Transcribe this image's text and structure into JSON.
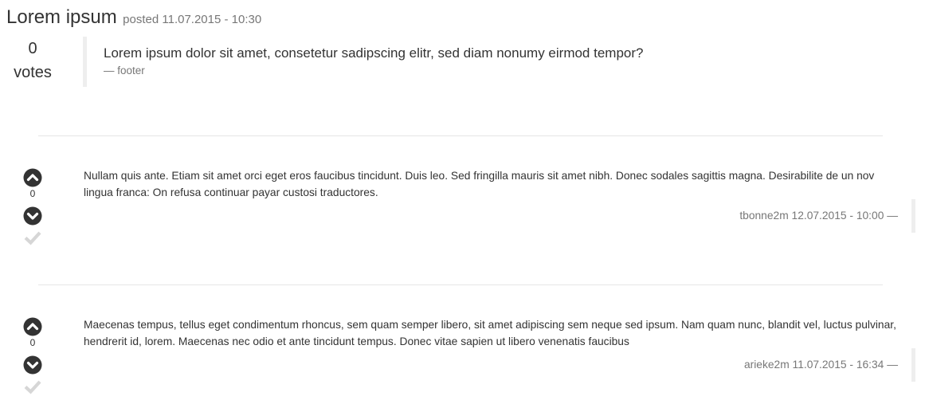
{
  "question": {
    "title": "Lorem ipsum",
    "posted": "posted 11.07.2015 - 10:30",
    "vote_count": "0",
    "vote_label": "votes",
    "text": "Lorem ipsum dolor sit amet, consetetur sadipscing elitr, sed diam nonumy eirmod tempor?",
    "footer": "— footer"
  },
  "answers": [
    {
      "votes": "0",
      "text": "Nullam quis ante. Etiam sit amet orci eget eros faucibus tincidunt. Duis leo. Sed fringilla mauris sit amet nibh. Donec sodales sagittis magna. Desirabilite de un nov lingua franca: On refusa continuar payar custosi traductores.",
      "meta": "tbonne2m 12.07.2015 - 10:00 —"
    },
    {
      "votes": "0",
      "text": "Maecenas tempus, tellus eget condimentum rhoncus, sem quam semper libero, sit amet adipiscing sem neque sed ipsum. Nam quam nunc, blandit vel, luctus pulvinar, hendrerit id, lorem. Maecenas nec odio et ante tincidunt tempus. Donec vitae sapien ut libero venenatis faucibus",
      "meta": "arieke2m 11.07.2015 - 16:34 —"
    }
  ],
  "colors": {
    "text": "#333333",
    "muted": "#777777",
    "accept_inactive": "#d6d6d6",
    "divider": "#e6e6e6",
    "quote_border": "#eeeeee"
  },
  "icons": {
    "upvote": "chevron-up-circle-icon",
    "downvote": "chevron-down-circle-icon",
    "accept": "checkmark-icon"
  }
}
